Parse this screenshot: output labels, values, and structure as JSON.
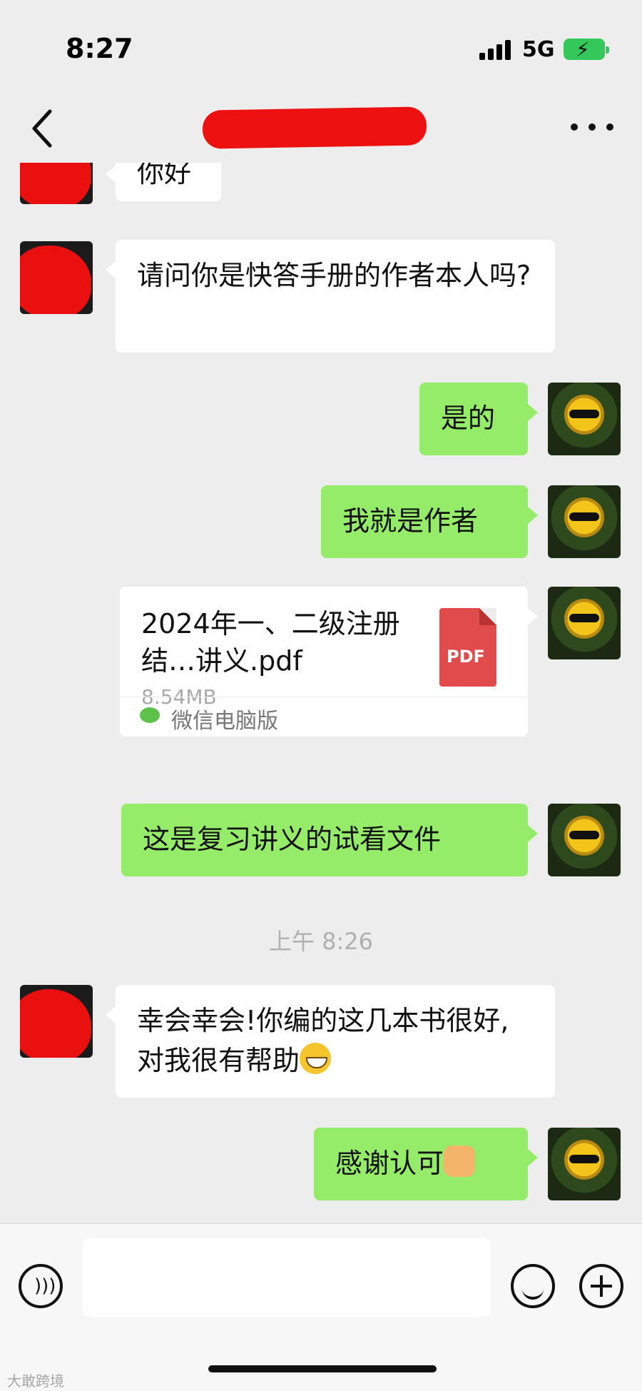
{
  "status_bar": {
    "time": "8:27",
    "network": "5G"
  },
  "nav": {
    "title": ""
  },
  "messages": {
    "m1": "你好",
    "m2": "请问你是快答手册的作者本人吗?",
    "m3": "是的",
    "m4": "我就是作者",
    "file": {
      "name": "2024年一、二级注册结…讲义.pdf",
      "size": "8.54MB",
      "icon_label": "PDF",
      "source": "微信电脑版"
    },
    "m5": "这是复习讲义的试看文件",
    "timestamp": "上午 8:26",
    "m6": "幸会幸会!你编的这几本书很好,对我很有帮助",
    "m7": "感谢认可"
  },
  "input": {
    "value": ""
  },
  "watermark": "大敢跨境",
  "colors": {
    "outgoing_bubble": "#95ec69",
    "incoming_bubble": "#ffffff",
    "background": "#ededed"
  }
}
